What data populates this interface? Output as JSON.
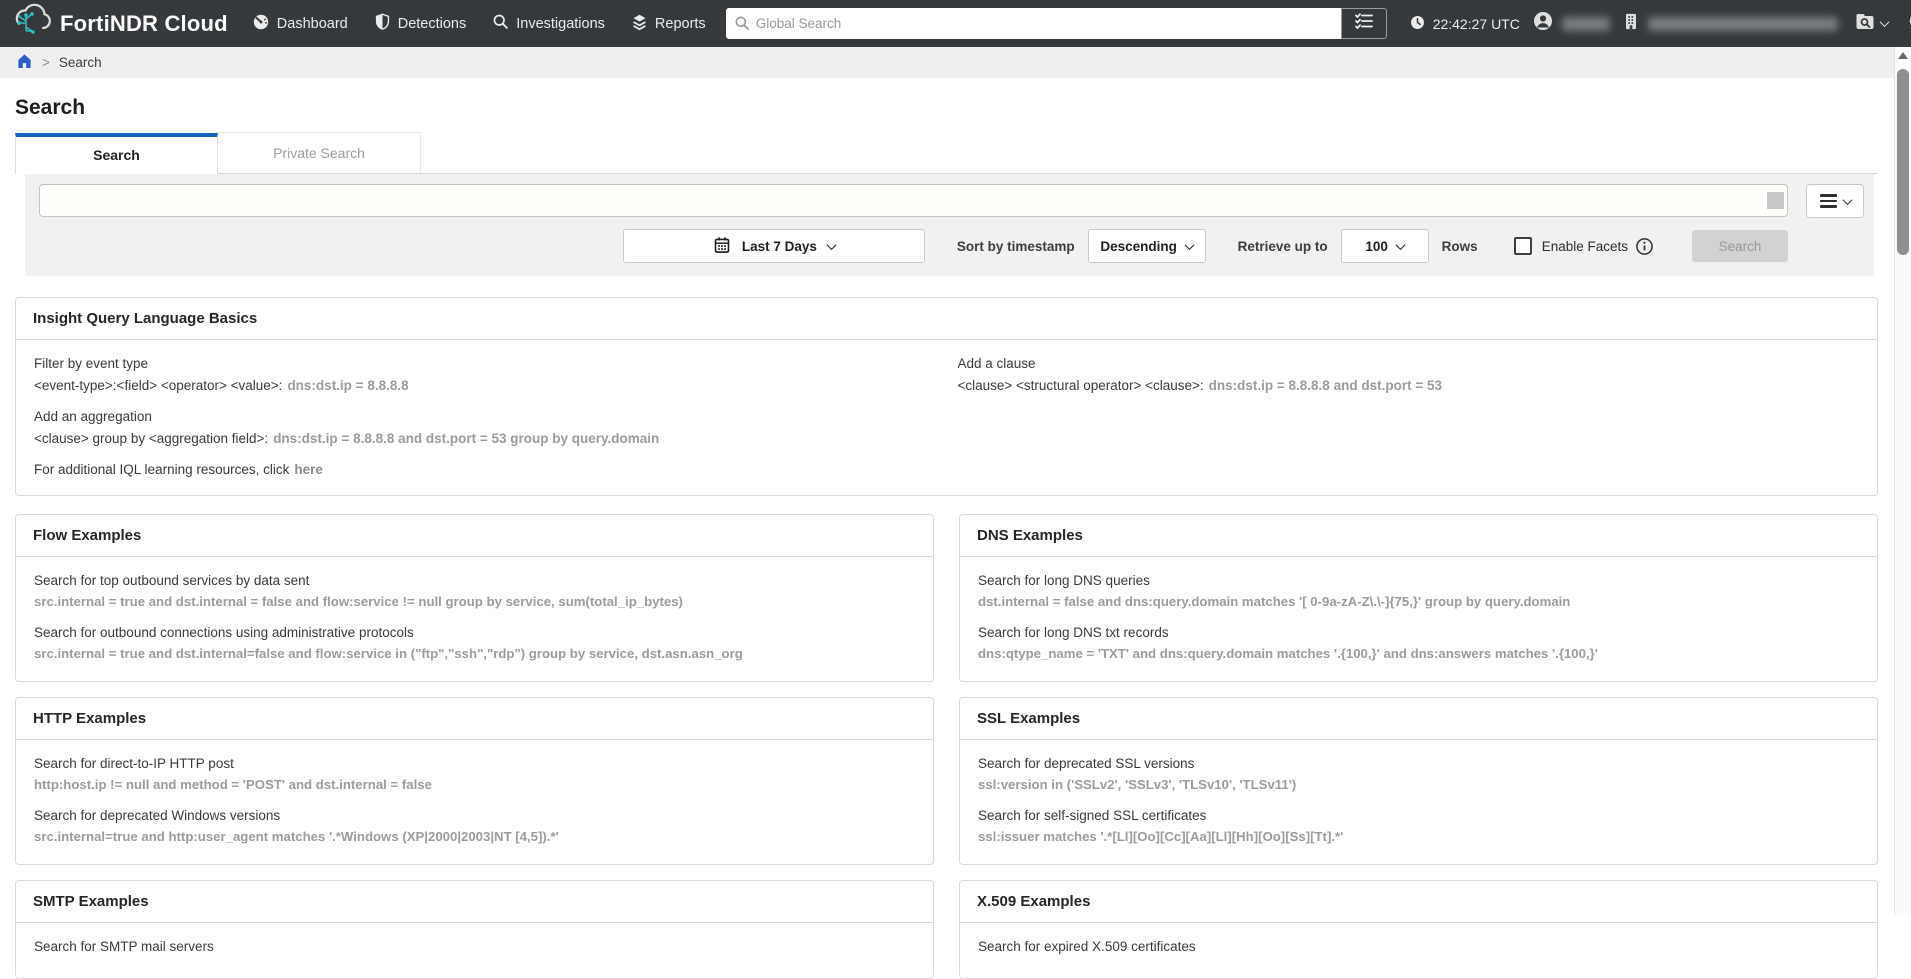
{
  "colors": {
    "header_bg": "#35393c",
    "accent_blue": "#1565c0",
    "logo_teal": "#28c3c3",
    "code_gray": "#9c9c9c"
  },
  "icons": {
    "gear-icon": "⚙"
  },
  "header": {
    "brand": "FortiNDR Cloud",
    "nav": [
      {
        "label": "Dashboard"
      },
      {
        "label": "Detections"
      },
      {
        "label": "Investigations"
      },
      {
        "label": "Reports"
      }
    ],
    "global_search_placeholder": "Global Search",
    "time": "22:42:27 UTC"
  },
  "breadcrumb": {
    "separator": ">",
    "current": "Search"
  },
  "page_title": "Search",
  "tabs": {
    "search": "Search",
    "private_search": "Private Search"
  },
  "toolbar": {
    "date_range": "Last 7 Days",
    "sort_label": "Sort by timestamp",
    "sort_value": "Descending",
    "retrieve_label": "Retrieve up to",
    "retrieve_value": "100",
    "rows_label": "Rows",
    "facets_label": "Enable Facets",
    "search_button": "Search"
  },
  "iql": {
    "title": "Insight Query Language Basics",
    "filter": {
      "label": "Filter by event type",
      "syntax": "<event-type>:<field> <operator> <value>:",
      "code": "dns:dst.ip = 8.8.8.8"
    },
    "clause": {
      "label": "Add a clause",
      "syntax": "<clause> <structural operator> <clause>:",
      "code": "dns:dst.ip = 8.8.8.8 and dst.port = 53"
    },
    "aggregation": {
      "label": "Add an aggregation",
      "syntax": "<clause> group by <aggregation field>:",
      "code": "dns:dst.ip = 8.8.8.8 and dst.port = 53 group by query.domain"
    },
    "footer_text": "For additional IQL learning resources, click",
    "footer_link": "here"
  },
  "panels": {
    "flow": {
      "title": "Flow Examples",
      "ex1": {
        "label": "Search for top outbound services by data sent",
        "code": "src.internal = true and dst.internal = false and flow:service != null group by service, sum(total_ip_bytes)"
      },
      "ex2": {
        "label": "Search for outbound connections using administrative protocols",
        "code": "src.internal = true and dst.internal=false and flow:service in (\"ftp\",\"ssh\",\"rdp\") group by service, dst.asn.asn_org"
      }
    },
    "dns": {
      "title": "DNS Examples",
      "ex1": {
        "label": "Search for long DNS queries",
        "code": "dst.internal = false and dns:query.domain matches '[ 0-9a-zA-Z\\.\\-]{75,}' group by query.domain"
      },
      "ex2": {
        "label": "Search for long DNS txt records",
        "code": "dns:qtype_name = 'TXT' and dns:query.domain matches '.{100,}' and dns:answers matches '.{100,}'"
      }
    },
    "http": {
      "title": "HTTP Examples",
      "ex1": {
        "label": "Search for direct-to-IP HTTP post",
        "code": "http:host.ip != null and method = 'POST' and dst.internal = false"
      },
      "ex2": {
        "label": "Search for deprecated Windows versions",
        "code": "src.internal=true and http:user_agent matches '.*Windows (XP|2000|2003|NT [4,5]).*'"
      }
    },
    "ssl": {
      "title": "SSL Examples",
      "ex1": {
        "label": "Search for deprecated SSL versions",
        "code": "ssl:version in ('SSLv2', 'SSLv3', 'TLSv10', 'TLSv11')"
      },
      "ex2": {
        "label": "Search for self-signed SSL certificates",
        "code": "ssl:issuer matches '.*[Ll][Oo][Cc][Aa][Ll][Hh][Oo][Ss][Tt].*'"
      }
    },
    "smtp": {
      "title": "SMTP Examples",
      "ex1": {
        "label": "Search for SMTP mail servers"
      }
    },
    "x509": {
      "title": "X.509 Examples",
      "ex1": {
        "label": "Search for expired X.509 certificates"
      }
    }
  }
}
